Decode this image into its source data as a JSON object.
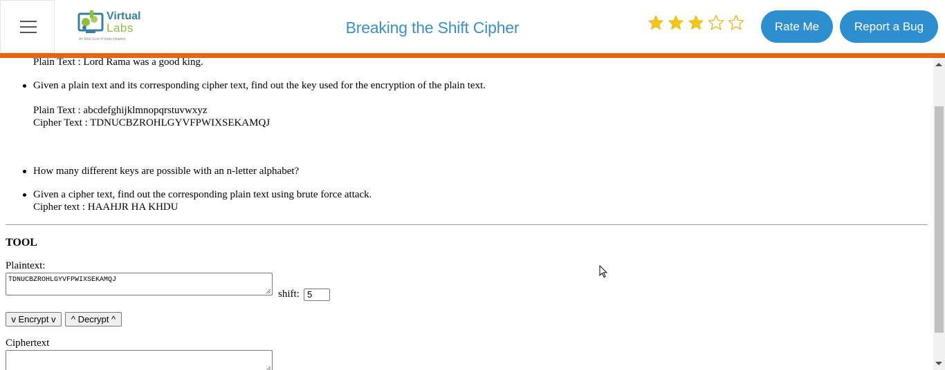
{
  "header": {
    "logo": {
      "word1": "Virtual",
      "word2": "Labs",
      "tagline": "An MoE Govt of India Initiative"
    },
    "title": "Breaking the Shift Cipher",
    "rating": {
      "value": 3,
      "max": 5
    },
    "rate_button": "Rate Me",
    "bug_button": "Report a Bug",
    "colors": {
      "accent": "#2d8fce",
      "title": "#3d8fc4",
      "orange_bar": "#e8650f",
      "star_filled": "#f5c518"
    }
  },
  "content": {
    "exercises": {
      "partial_line": "Plain Text : Lord Rama was a good king.",
      "item2": {
        "text": "Given a plain text and its corresponding cipher text, find out the key used for the encryption of the plain text.",
        "plain": "Plain Text : abcdefghijklmnopqrstuvwxyz",
        "cipher": "Cipher Text : TDNUCBZROHLGYVFPWIXSEKAMQJ"
      },
      "item3": {
        "text": "How many different keys are possible with an n-letter alphabet?"
      },
      "item4": {
        "text": "Given a cipher text, find out the corresponding plain text using brute force attack.",
        "cipher": "Cipher text : HAAHJR HA KHDU"
      }
    },
    "tool": {
      "heading": "TOOL",
      "plaintext_label": "Plaintext:",
      "plaintext_value": "TDNUCBZROHLGYVFPWIXSEKAMQJ",
      "shift_label": "shift:",
      "shift_value": "5",
      "encrypt_button": "v Encrypt v",
      "decrypt_button": "^ Decrypt ^",
      "ciphertext_label": "Ciphertext",
      "ciphertext_value": ""
    }
  }
}
